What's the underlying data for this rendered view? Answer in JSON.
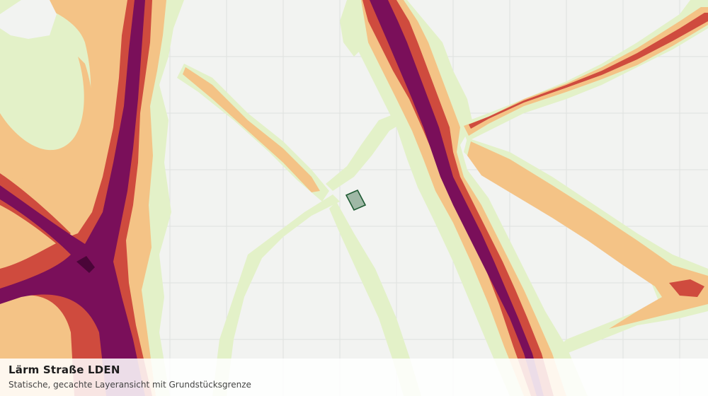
{
  "map": {
    "layer": "Lärm Straße LDEN",
    "colors": {
      "background": "#f2f3f1",
      "grid": "#dfe2de",
      "band_lightest": "#e3f1c8",
      "band_light": "#f4c386",
      "band_mid": "#cf4b3e",
      "band_dark": "#7a0f5a",
      "band_darkest": "#4a0538",
      "parcel_fill": "#9fb8a6",
      "parcel_stroke": "#1f5b34"
    }
  },
  "caption": {
    "title": "Lärm Straße LDEN",
    "subtitle": "Statische, gecachte Layeransicht mit Grundstücksgrenze"
  }
}
